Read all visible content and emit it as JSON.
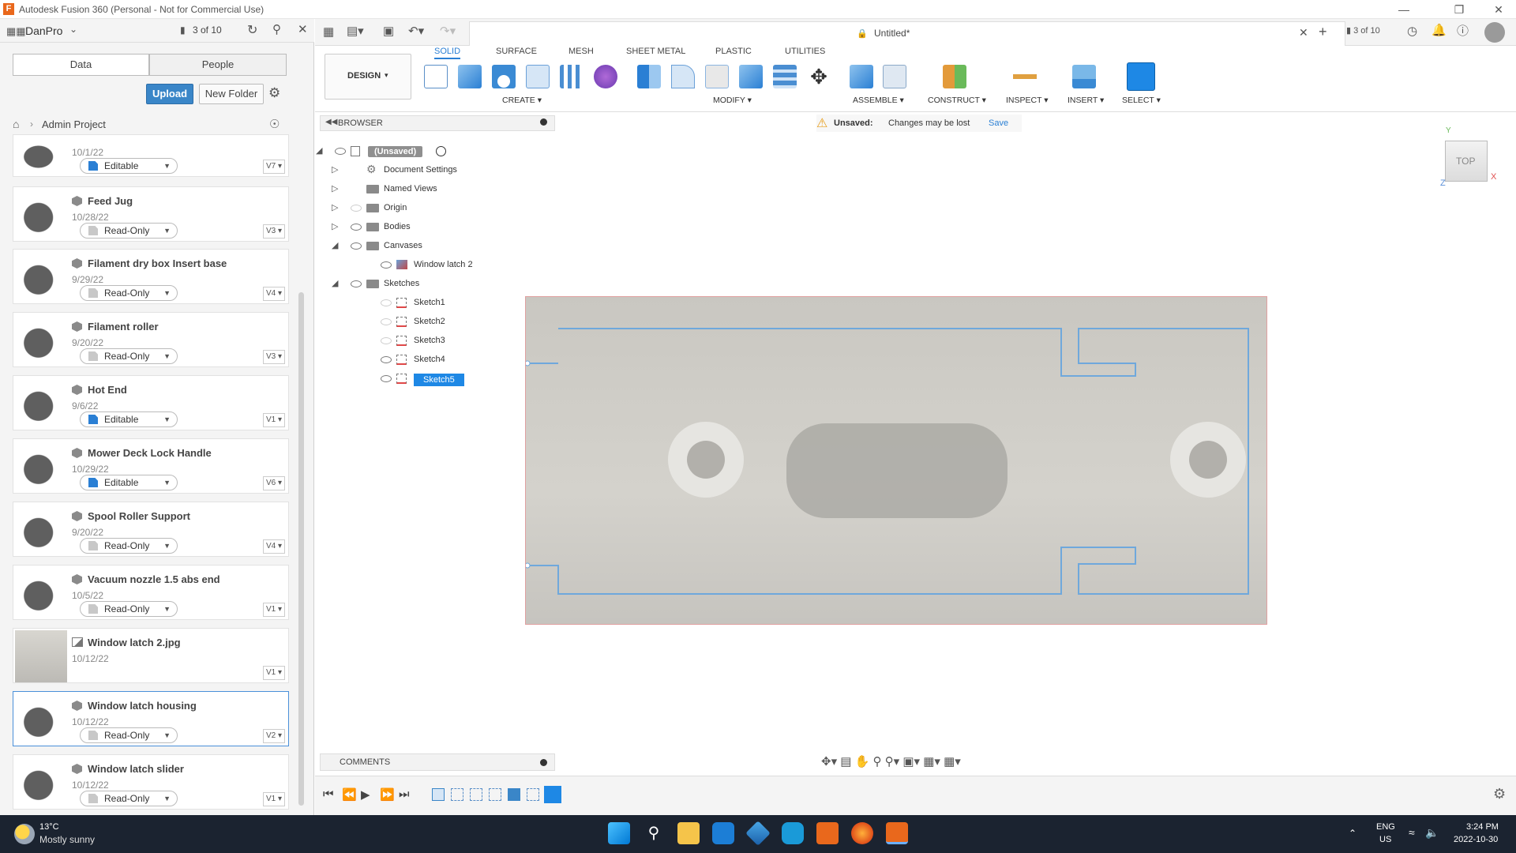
{
  "window": {
    "title": "Autodesk Fusion 360 (Personal - Not for Commercial Use)"
  },
  "left_panel": {
    "user": "DanPro",
    "job_counter": "3 of 10",
    "tabs": [
      "Data",
      "People"
    ],
    "upload_label": "Upload",
    "new_folder_label": "New Folder",
    "breadcrumb": "Admin Project",
    "items": [
      {
        "name": "",
        "date": "10/1/22",
        "permission": "Editable",
        "version": "V7"
      },
      {
        "name": "Feed Jug",
        "date": "10/28/22",
        "permission": "Read-Only",
        "version": "V3"
      },
      {
        "name": "Filament dry box Insert base",
        "date": "9/29/22",
        "permission": "Read-Only",
        "version": "V4"
      },
      {
        "name": "Filament roller",
        "date": "9/20/22",
        "permission": "Read-Only",
        "version": "V3"
      },
      {
        "name": "Hot End",
        "date": "9/6/22",
        "permission": "Editable",
        "version": "V1"
      },
      {
        "name": "Mower Deck Lock Handle",
        "date": "10/29/22",
        "permission": "Editable",
        "version": "V6"
      },
      {
        "name": "Spool Roller Support",
        "date": "9/20/22",
        "permission": "Read-Only",
        "version": "V4"
      },
      {
        "name": "Vacuum nozzle 1.5 abs end",
        "date": "10/5/22",
        "permission": "Read-Only",
        "version": "V1"
      },
      {
        "name": "Window latch 2.jpg",
        "date": "10/12/22",
        "permission": "",
        "version": "V1"
      },
      {
        "name": "Window latch housing",
        "date": "10/12/22",
        "permission": "Read-Only",
        "version": "V2"
      },
      {
        "name": "Window latch slider",
        "date": "10/12/22",
        "permission": "Read-Only",
        "version": "V1"
      }
    ]
  },
  "document": {
    "tab_title": "Untitled*",
    "job_counter": "3 of 10"
  },
  "ribbon": {
    "workspace": "DESIGN",
    "tabs": [
      "SOLID",
      "SURFACE",
      "MESH",
      "SHEET METAL",
      "PLASTIC",
      "UTILITIES"
    ],
    "groups": [
      "CREATE",
      "MODIFY",
      "ASSEMBLE",
      "CONSTRUCT",
      "INSPECT",
      "INSERT",
      "SELECT"
    ]
  },
  "browser": {
    "header": "BROWSER",
    "root": "(Unsaved)",
    "nodes": [
      "Document Settings",
      "Named Views",
      "Origin",
      "Bodies",
      "Canvases",
      "Window latch 2",
      "Sketches",
      "Sketch1",
      "Sketch2",
      "Sketch3",
      "Sketch4",
      "Sketch5"
    ]
  },
  "unsaved_bar": {
    "label": "Unsaved:",
    "message": "Changes may be lost",
    "save": "Save"
  },
  "viewcube": {
    "face": "TOP",
    "x": "X",
    "y": "Y",
    "z": "Z"
  },
  "comments": {
    "label": "COMMENTS"
  },
  "taskbar": {
    "weather_temp": "13°C",
    "weather_desc": "Mostly sunny",
    "lang": "ENG",
    "region": "US",
    "time": "3:24 PM",
    "date": "2022-10-30"
  },
  "colors": {
    "accent": "#2a7fd4",
    "taskbar": "#1b2330",
    "sketch_line": "#6fa8dc"
  }
}
